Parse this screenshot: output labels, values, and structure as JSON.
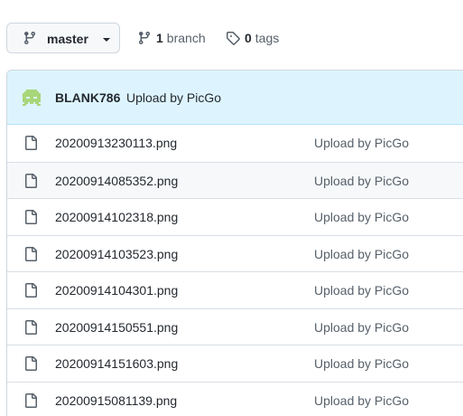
{
  "toolbar": {
    "branch_name": "master",
    "branch_count": "1",
    "branch_label": "branch",
    "tag_count": "0",
    "tag_label": "tags"
  },
  "commit": {
    "author": "BLANK786",
    "message": "Upload by PicGo",
    "avatar_color": "#a8d67a"
  },
  "files": [
    {
      "name": "20200913230113.png",
      "commit": "Upload by PicGo"
    },
    {
      "name": "20200914085352.png",
      "commit": "Upload by PicGo"
    },
    {
      "name": "20200914102318.png",
      "commit": "Upload by PicGo"
    },
    {
      "name": "20200914103523.png",
      "commit": "Upload by PicGo"
    },
    {
      "name": "20200914104301.png",
      "commit": "Upload by PicGo"
    },
    {
      "name": "20200914150551.png",
      "commit": "Upload by PicGo"
    },
    {
      "name": "20200914151603.png",
      "commit": "Upload by PicGo"
    },
    {
      "name": "20200915081139.png",
      "commit": "Upload by PicGo"
    }
  ],
  "icons": {
    "branch": "git-branch-icon",
    "tag": "tag-icon",
    "file": "file-icon"
  }
}
